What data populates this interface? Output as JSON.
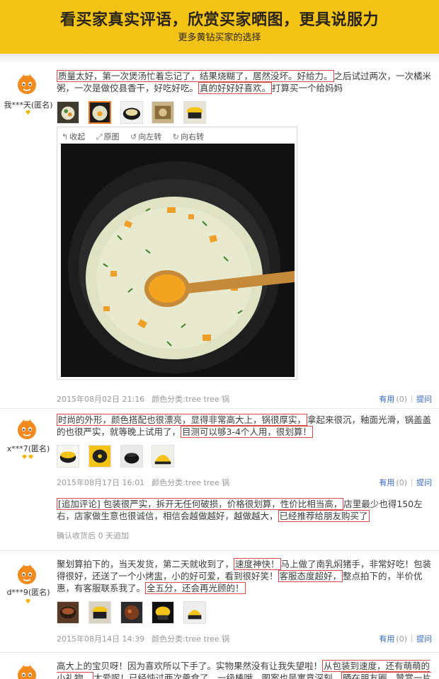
{
  "banner": {
    "title": "看买家真实评语，欣赏买家晒图，更具说服力",
    "subtitle": "更多黄钻买家的选择"
  },
  "viewer_tools": [
    "收起",
    "原图",
    "向左转",
    "向右转"
  ],
  "actions": {
    "useful": "有用",
    "count": "(0)",
    "reply": "提问"
  },
  "reviews": [
    {
      "user": "我***天(匿名)",
      "diamonds": 1,
      "content_parts": [
        {
          "t": "质量太好，第一次煲汤忙着忘记了，结果烧糊了，居然没坏。好给力。",
          "hl": true
        },
        {
          "t": "之后试过两次，一次橘米粥，一次是做佼县香干，好吃好吃。",
          "hl": false
        },
        {
          "t": "真的好好好喜欢。",
          "hl": true
        },
        {
          "t": "打算买一个给妈妈",
          "hl": false
        }
      ],
      "thumbs": 5,
      "active_thumb": 1,
      "date": "2015年08月02日 21:16",
      "variant": "颜色分类:tree tree 锅"
    },
    {
      "user": "x***7(匿名)",
      "diamonds": 2,
      "content_parts": [
        {
          "t": "时尚的外形，颜色搭配也很漂亮，显得非常高大上，锅很厚实，",
          "hl": true
        },
        {
          "t": "拿起来很沉，釉面光滑，锅盖盖的也很严实，就等晚上试用了，",
          "hl": false
        },
        {
          "t": "目测可以够3-4个人用，很划算！",
          "hl": true
        }
      ],
      "thumbs": 4,
      "date": "2015年08月17日 16:01",
      "variant": "颜色分类:tree tree 锅",
      "append": {
        "parts": [
          {
            "t": "[追加评论] 包装很严实，拆开无任何破损，价格很划算，性价比相当高，",
            "hl": true
          },
          {
            "t": "店里最少也得150左右，店家做生意也很诚信，相信会越做越好，越做越大，",
            "hl": false
          },
          {
            "t": "已经推荐给朋友购买了",
            "hl": true
          }
        ],
        "meta": "确认收货后 0 天追加"
      }
    },
    {
      "user": "d***9(匿名)",
      "diamonds": 1,
      "content_parts": [
        {
          "t": "聚划算拍下的，当天发货，第二天就收到了，",
          "hl": false
        },
        {
          "t": "速度神快！",
          "hl": true
        },
        {
          "t": "马上做了南乳焖猪手，非常好吃！包装得很好，还送了一个小烤盅，小的好可爱，看到很好笑！",
          "hl": false
        },
        {
          "t": "客服态度超好，",
          "hl": true
        },
        {
          "t": "整点拍下的，半价优惠，有客服联系我了。",
          "hl": false
        },
        {
          "t": "全五分，还会再光顾的！",
          "hl": true
        }
      ],
      "thumbs": 5,
      "date": "2015年08月14日 14:39",
      "variant": "颜色分类:tree tree 锅"
    },
    {
      "user": "",
      "diamonds": 0,
      "content_parts": [
        {
          "t": "高大上的宝贝呀！因为喜欢所以下手了。实物果然没有让我失望啦！",
          "hl": false
        },
        {
          "t": "从包装到速度，还有萌萌的小礼物。",
          "hl": true
        },
        {
          "t": "太爱呢！已经炖过两次羹食了，一级棒哦。图案也是寓意深刻，",
          "hl": false
        },
        {
          "t": "晒在朋友圈，赞赏一片呢！",
          "hl": true
        }
      ],
      "thumbs": 0,
      "date": "",
      "variant": ""
    }
  ]
}
